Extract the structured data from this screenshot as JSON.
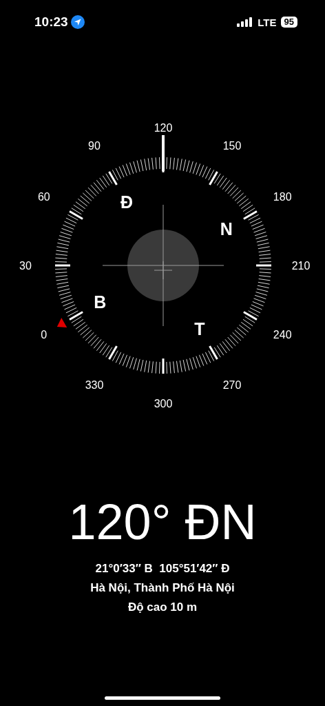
{
  "status_bar": {
    "time": "10:23",
    "network": "LTE",
    "battery": "95"
  },
  "compass": {
    "degree_labels": [
      "0",
      "30",
      "60",
      "90",
      "120",
      "150",
      "180",
      "210",
      "240",
      "270",
      "300",
      "330"
    ],
    "cardinals": [
      "B",
      "Đ",
      "N",
      "T"
    ]
  },
  "heading": "120° ĐN",
  "coordinates": "21°0′33″ B  105°51′42″ Đ",
  "place": "Hà Nội, Thành Phố Hà Nội",
  "altitude": "Độ cao 10 m"
}
